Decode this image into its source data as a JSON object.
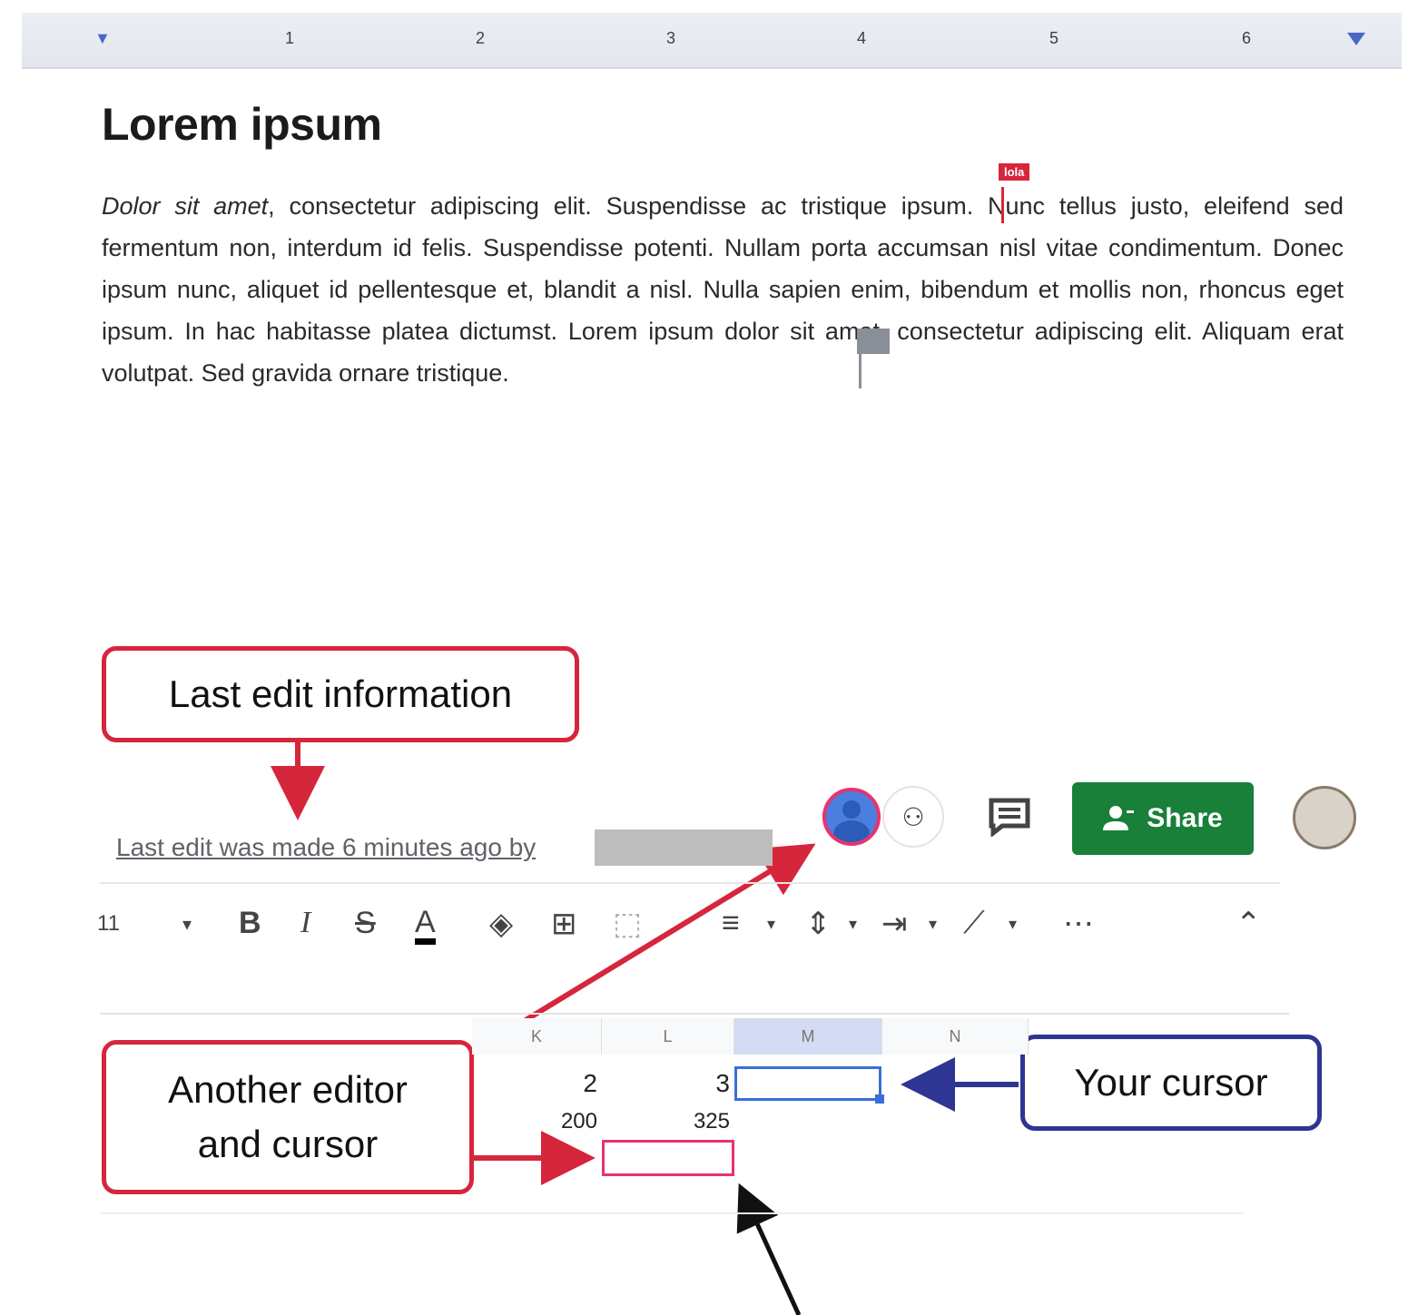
{
  "ruler": {
    "numbers": [
      "1",
      "2",
      "3",
      "4",
      "5",
      "6"
    ]
  },
  "document": {
    "title": "Lorem ipsum",
    "body_italic": "Dolor sit amet",
    "body_rest": ", consectetur adipiscing elit. Suspendisse ac tristique ipsum. Nunc tellus justo, eleifend sed fermentum non, interdum id felis. Suspendisse potenti. Nullam porta accumsan nisl vitae condimentum. Donec ipsum nunc, aliquet id pellentesque et, blandit a nisl. Nulla sapien enim, bibendum et mollis non, rhoncus eget ipsum. In hac habitasse platea dictumst. Lorem ipsum dolor sit amet, consectetur adipiscing elit. Aliquam erat volutpat. Sed gravida ornare tristique.",
    "remote_cursor_label": "lola"
  },
  "annotations": {
    "last_edit_info": "Last edit information",
    "another_editor_line1": "Another editor",
    "another_editor_line2": "and cursor",
    "your_cursor": "Your cursor"
  },
  "header": {
    "last_edit_text": "Last edit was made 6 minutes ago by",
    "share_label": "Share"
  },
  "toolbar": {
    "font_size": "11",
    "bold": "B",
    "italic": "I",
    "strikethrough": "S",
    "text_color": "A",
    "more": "⋯"
  },
  "sheet": {
    "columns": [
      "K",
      "L",
      "M",
      "N"
    ],
    "row1": [
      "2",
      "3"
    ],
    "row2": [
      "200",
      "325"
    ]
  },
  "colors": {
    "red_annotation": "#d6263c",
    "blue_annotation": "#2e3592",
    "share_green": "#188038",
    "selection_blue": "#3b6fd8",
    "collaborator_pink": "#e8336d"
  }
}
